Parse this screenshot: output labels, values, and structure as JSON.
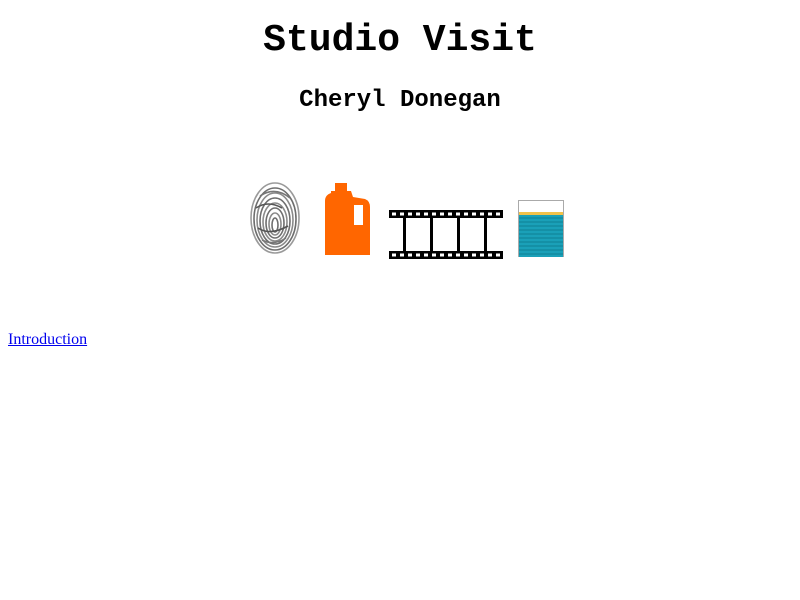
{
  "page": {
    "title": "Studio Visit",
    "subtitle": "Cheryl Donegan"
  },
  "icons": [
    {
      "name": "fingerprint-icon",
      "color": "#888888"
    },
    {
      "name": "detergent-jug-icon",
      "color": "#ff6600"
    },
    {
      "name": "film-strip-icon",
      "color": "#000000"
    },
    {
      "name": "water-glass-icon",
      "color": "#1aa0b8"
    }
  ],
  "links": {
    "introduction": "Introduction"
  },
  "colors": {
    "link": "#0000ee",
    "background": "#ffffff",
    "text": "#000000"
  }
}
